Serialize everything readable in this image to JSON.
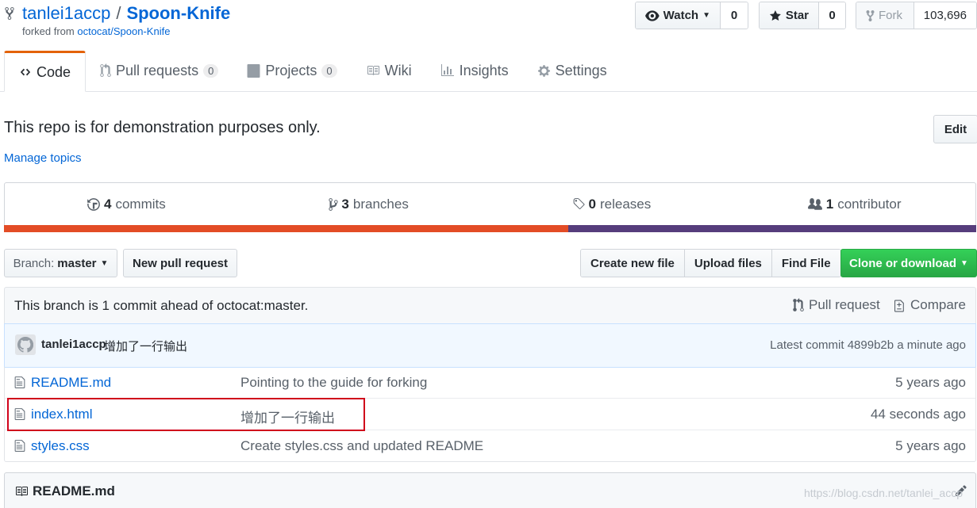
{
  "repo": {
    "owner": "tanlei1accp",
    "slash": "/",
    "name": "Spoon-Knife",
    "forked_from_prefix": "forked from ",
    "forked_from_link": "octocat/Spoon-Knife"
  },
  "actions": {
    "watch_label": "Watch",
    "watch_count": "0",
    "star_label": "Star",
    "star_count": "0",
    "fork_label": "Fork",
    "fork_count": "103,696"
  },
  "tabs": [
    {
      "label": "Code",
      "icon": "code-icon"
    },
    {
      "label": "Pull requests",
      "count": "0",
      "icon": "pull-request-icon"
    },
    {
      "label": "Projects",
      "count": "0",
      "icon": "project-icon"
    },
    {
      "label": "Wiki",
      "icon": "book-icon"
    },
    {
      "label": "Insights",
      "icon": "graph-icon"
    },
    {
      "label": "Settings",
      "icon": "gear-icon"
    }
  ],
  "description": "This repo is for demonstration purposes only.",
  "manage_topics": "Manage topics",
  "edit_label": "Edit",
  "summary": {
    "commits_count": "4",
    "commits_label": "commits",
    "branches_count": "3",
    "branches_label": "branches",
    "releases_count": "0",
    "releases_label": "releases",
    "contributors_count": "1",
    "contributors_label": "contributor"
  },
  "language_bar": [
    {
      "color": "#e34c26",
      "fraction": 0.58
    },
    {
      "color": "#563d7c",
      "fraction": 0.42
    }
  ],
  "file_nav": {
    "branch_prefix": "Branch:",
    "branch_value": "master",
    "new_pr": "New pull request",
    "create_file": "Create new file",
    "upload_files": "Upload files",
    "find_file": "Find File",
    "clone": "Clone or download"
  },
  "ahead": {
    "message": "This branch is 1 commit ahead of octocat:master.",
    "pull_request": "Pull request",
    "compare": "Compare"
  },
  "commit_tease": {
    "author": "tanlei1accp",
    "message": "增加了一行输出",
    "latest": "Latest commit 4899b2b a minute ago"
  },
  "files": [
    {
      "name": "README.md",
      "message": "Pointing to the guide for forking",
      "age": "5 years ago"
    },
    {
      "name": "index.html",
      "message": "增加了一行输出",
      "age": "44 seconds ago"
    },
    {
      "name": "styles.css",
      "message": "Create styles.css and updated README",
      "age": "5 years ago"
    }
  ],
  "readme_title": "README.md",
  "watermark": "https://blog.csdn.net/tanlei_accp",
  "colors": {
    "accent": "#0366d6",
    "tab_selected": "#e36209",
    "clone_green": "#28a745",
    "highlight_red": "#d0021b"
  }
}
